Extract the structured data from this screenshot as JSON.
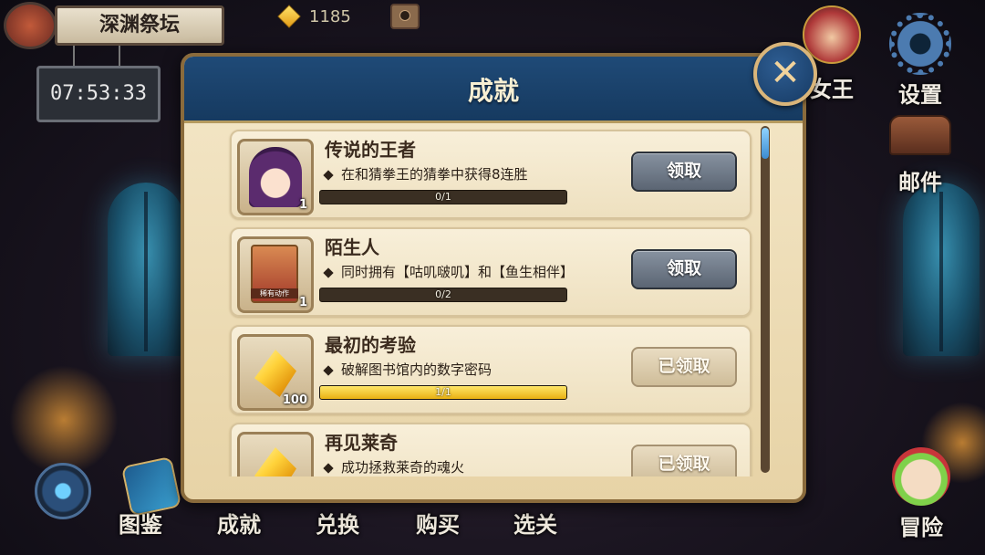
{
  "location": {
    "name": "深渊祭坛",
    "timer": "07:53:33"
  },
  "currency": {
    "gems": "1185"
  },
  "side_menu": {
    "queen": "女王",
    "settings": "设置",
    "mail": "邮件",
    "adventure": "冒险"
  },
  "bottom_nav": [
    "图鉴",
    "成就",
    "兑换",
    "购买",
    "选关"
  ],
  "modal": {
    "title": "成就",
    "close_symbol": "✕",
    "achievements": [
      {
        "title": "传说的王者",
        "description": "在和猜拳王的猜拳中获得8连胜",
        "reward_count": "1",
        "progress_text": "0/1",
        "progress": 0,
        "button": "领取",
        "state": "claimable",
        "reward": "portrait"
      },
      {
        "title": "陌生人",
        "description": "同时拥有【咕叽啵叽】和【鱼生相伴】",
        "reward_count": "1",
        "reward_caption": "稀有动作",
        "progress_text": "0/2",
        "progress": 0,
        "button": "领取",
        "state": "claimable",
        "reward": "card"
      },
      {
        "title": "最初的考验",
        "description": "破解图书馆内的数字密码",
        "reward_count": "100",
        "progress_text": "1/1",
        "progress": 1,
        "button": "已领取",
        "state": "claimed",
        "reward": "gem"
      },
      {
        "title": "再见莱奇",
        "description": "成功拯救莱奇的魂火",
        "reward_count": "",
        "progress_text": "",
        "progress": 1,
        "button": "已领取",
        "state": "claimed",
        "reward": "gem"
      }
    ]
  },
  "colors": {
    "header_blue": "#1f4a77",
    "parchment": "#f4e7c8",
    "gold": "#ffd23a",
    "claim_gray": "#6b7583"
  }
}
